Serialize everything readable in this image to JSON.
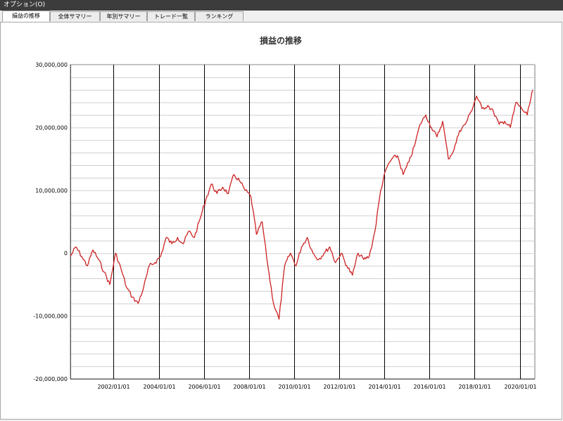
{
  "menubar": {
    "label": "オプション(O)"
  },
  "tabs": [
    {
      "label": "損益の推移",
      "active": true
    },
    {
      "label": "全体サマリー",
      "active": false
    },
    {
      "label": "年別サマリー",
      "active": false
    },
    {
      "label": "トレード一覧",
      "active": false
    },
    {
      "label": "ランキング",
      "active": false
    }
  ],
  "colors": {
    "line": "#cc2222",
    "grid_minor": "#cfcfcf",
    "grid_major": "#000000"
  },
  "chart_data": {
    "type": "line",
    "title": "損益の推移",
    "ylim": [
      -20000000,
      30000000
    ],
    "y_ticks": [
      30000000,
      20000000,
      10000000,
      0,
      -10000000,
      -20000000
    ],
    "y_tick_labels": [
      "30,000,000",
      "20,000,000",
      "10,000,000",
      "0",
      "-10,000,000",
      "-20,000,000"
    ],
    "y_minor_step": 2000000,
    "xlim": [
      "2000/02/01",
      "2020/09/01"
    ],
    "x_ticks": [
      "2002/01/01",
      "2004/01/01",
      "2006/01/01",
      "2008/01/01",
      "2010/01/01",
      "2012/01/01",
      "2014/01/01",
      "2016/01/01",
      "2018/01/01",
      "2020/01/01"
    ],
    "grid": true,
    "series": [
      {
        "x": [
          "2000/02",
          "2000/05",
          "2000/08",
          "2000/11",
          "2001/02",
          "2001/05",
          "2001/08",
          "2001/11",
          "2002/02",
          "2002/05",
          "2002/08",
          "2002/11",
          "2003/02",
          "2003/05",
          "2003/08",
          "2003/11",
          "2004/02",
          "2004/05",
          "2004/08",
          "2004/11",
          "2005/02",
          "2005/05",
          "2005/08",
          "2005/11",
          "2006/02",
          "2006/05",
          "2006/08",
          "2006/11",
          "2007/02",
          "2007/05",
          "2007/08",
          "2007/11",
          "2008/02",
          "2008/05",
          "2008/08",
          "2008/11",
          "2009/02",
          "2009/05",
          "2009/08",
          "2009/11",
          "2010/02",
          "2010/05",
          "2010/08",
          "2010/11",
          "2011/02",
          "2011/05",
          "2011/08",
          "2011/11",
          "2012/02",
          "2012/05",
          "2012/08",
          "2012/11",
          "2013/02",
          "2013/05",
          "2013/08",
          "2013/11",
          "2014/02",
          "2014/05",
          "2014/08",
          "2014/11",
          "2015/02",
          "2015/05",
          "2015/08",
          "2015/11",
          "2016/02",
          "2016/05",
          "2016/08",
          "2016/11",
          "2017/02",
          "2017/05",
          "2017/08",
          "2017/11",
          "2018/02",
          "2018/05",
          "2018/08",
          "2018/11",
          "2019/02",
          "2019/05",
          "2019/08",
          "2019/11",
          "2020/02",
          "2020/05",
          "2020/08"
        ],
        "values": [
          -500000,
          1000000,
          -500000,
          -2000000,
          500000,
          -1000000,
          -3000000,
          -5000000,
          0,
          -2500000,
          -5500000,
          -7000000,
          -8000000,
          -5500000,
          -2000000,
          -1500000,
          -500000,
          2500000,
          1500000,
          2500000,
          1500000,
          3500000,
          2500000,
          5500000,
          8500000,
          11000000,
          9500000,
          10500000,
          9500000,
          12500000,
          11500000,
          10000000,
          9000000,
          3000000,
          5000000,
          -2000000,
          -8000000,
          -10500000,
          -2000000,
          0,
          -2000000,
          1000000,
          2500000,
          0,
          -1000000,
          0,
          1000000,
          -1500000,
          0,
          -2000000,
          -3500000,
          0,
          -1000000,
          -500000,
          3500000,
          10000000,
          13500000,
          15000000,
          15500000,
          12500000,
          14500000,
          17000000,
          20500000,
          22000000,
          20000000,
          18500000,
          21000000,
          15000000,
          16500000,
          19500000,
          20500000,
          22500000,
          25000000,
          23000000,
          23500000,
          22500000,
          20500000,
          21000000,
          20000000,
          24000000,
          23000000,
          22000000,
          26000000
        ]
      }
    ]
  }
}
